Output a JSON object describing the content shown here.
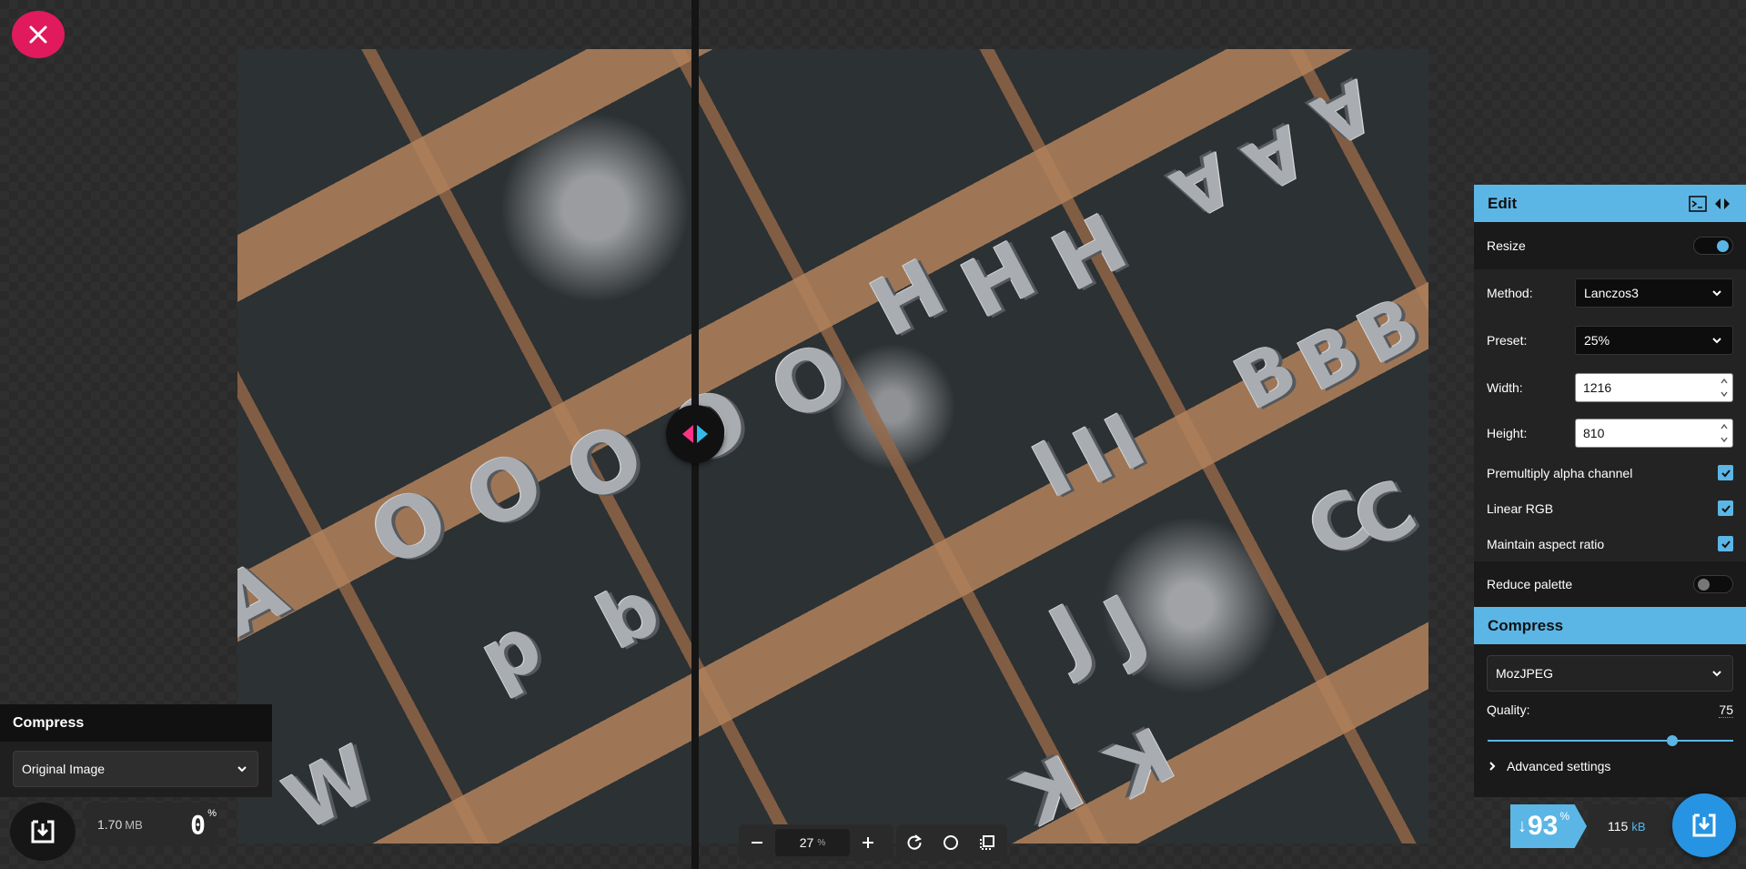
{
  "colors": {
    "accent": "#5bb6e6",
    "close": "#e01a5d",
    "download": "#2694e2"
  },
  "left": {
    "title": "Compress",
    "select_value": "Original Image",
    "size_value": "1.70",
    "size_unit": "MB",
    "percent": "0",
    "percent_sign": "%"
  },
  "toolbar": {
    "zoom_value": "27",
    "zoom_unit": "%"
  },
  "edit": {
    "title": "Edit",
    "resize_label": "Resize",
    "resize_on": true,
    "method_label": "Method:",
    "method_value": "Lanczos3",
    "preset_label": "Preset:",
    "preset_value": "25%",
    "width_label": "Width:",
    "width_value": "1216",
    "height_label": "Height:",
    "height_value": "810",
    "premultiply_label": "Premultiply alpha channel",
    "linear_rgb_label": "Linear RGB",
    "aspect_label": "Maintain aspect ratio",
    "reduce_palette_label": "Reduce palette",
    "reduce_palette_on": false
  },
  "compress": {
    "title": "Compress",
    "codec": "MozJPEG",
    "quality_label": "Quality:",
    "quality_value": "75",
    "quality_fraction": 0.75,
    "advanced_label": "Advanced settings"
  },
  "result": {
    "arrow": "↓",
    "percent": "93",
    "percent_sign": "%",
    "size_value": "115",
    "size_unit": "kB"
  },
  "photo_glyphs": [
    "O",
    "O",
    "O",
    "O",
    "O",
    "H",
    "H",
    "H",
    "B",
    "B",
    "B",
    "A",
    "A",
    "A",
    "I",
    "I",
    "I",
    "W",
    "K",
    "K",
    "C",
    "C",
    "p",
    "b",
    "J",
    "J",
    "A"
  ]
}
